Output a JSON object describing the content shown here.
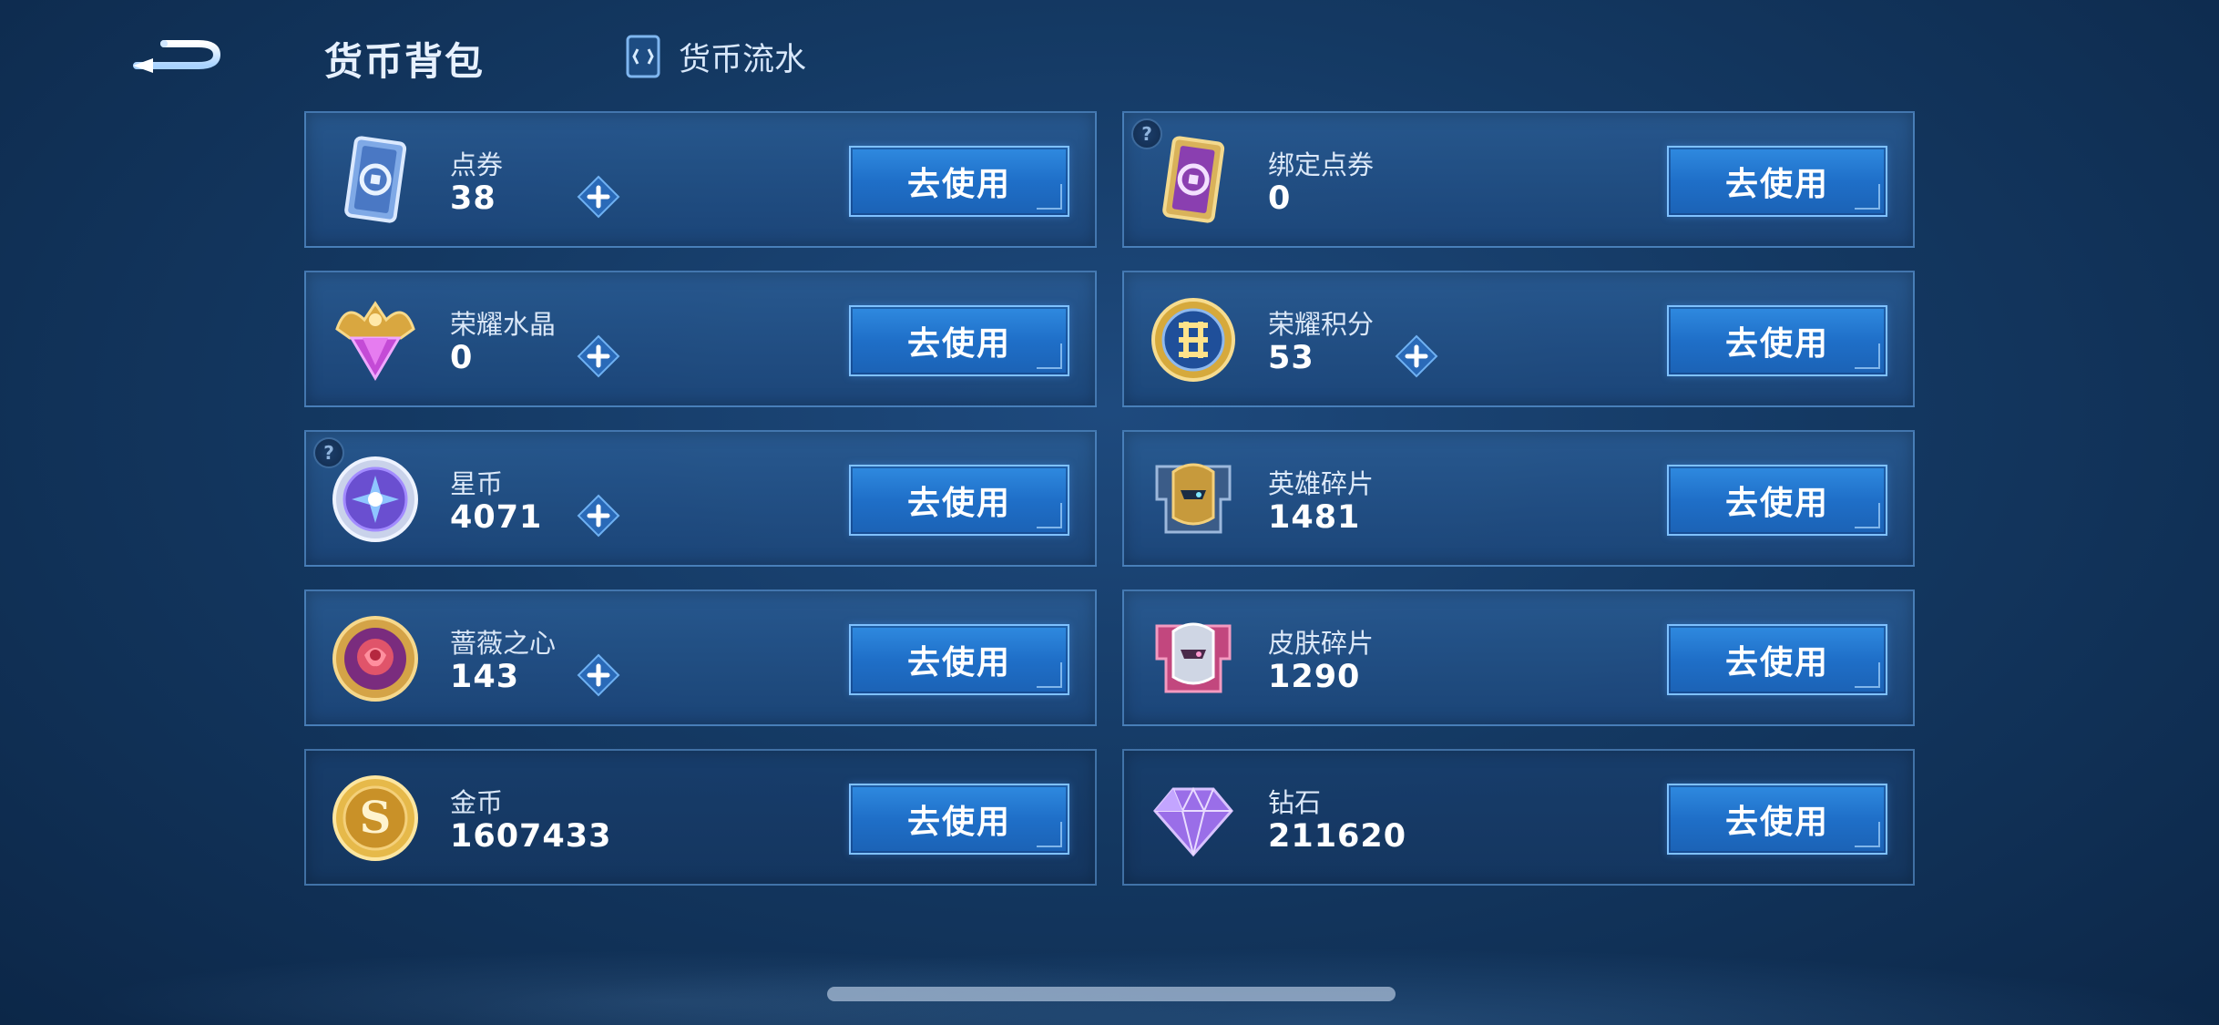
{
  "header": {
    "title": "货币背包",
    "flow_label": "货币流水"
  },
  "colors": {
    "accent": "#2f8ae0",
    "card_bg": "#24568e",
    "background": "#143963"
  },
  "currencies": [
    {
      "name": "点券",
      "value": "38",
      "button": "去使用",
      "icon": "blue-coupon-icon",
      "plus": true,
      "help": false
    },
    {
      "name": "绑定点券",
      "value": "0",
      "button": "去使用",
      "icon": "purple-coupon-icon",
      "plus": false,
      "help": true
    },
    {
      "name": "荣耀水晶",
      "value": "0",
      "button": "去使用",
      "icon": "glory-crystal-icon",
      "plus": true,
      "help": false
    },
    {
      "name": "荣耀积分",
      "value": "53",
      "button": "去使用",
      "icon": "glory-points-icon",
      "plus": true,
      "help": false
    },
    {
      "name": "星币",
      "value": "4071",
      "button": "去使用",
      "icon": "star-coin-icon",
      "plus": true,
      "help": true
    },
    {
      "name": "英雄碎片",
      "value": "1481",
      "button": "去使用",
      "icon": "hero-fragment-icon",
      "plus": false,
      "help": false
    },
    {
      "name": "蔷薇之心",
      "value": "143",
      "button": "去使用",
      "icon": "rose-heart-icon",
      "plus": true,
      "help": false
    },
    {
      "name": "皮肤碎片",
      "value": "1290",
      "button": "去使用",
      "icon": "skin-fragment-icon",
      "plus": false,
      "help": false
    },
    {
      "name": "金币",
      "value": "1607433",
      "button": "去使用",
      "icon": "gold-coin-icon",
      "plus": false,
      "help": false
    },
    {
      "name": "钻石",
      "value": "211620",
      "button": "去使用",
      "icon": "diamond-icon",
      "plus": false,
      "help": false
    }
  ]
}
